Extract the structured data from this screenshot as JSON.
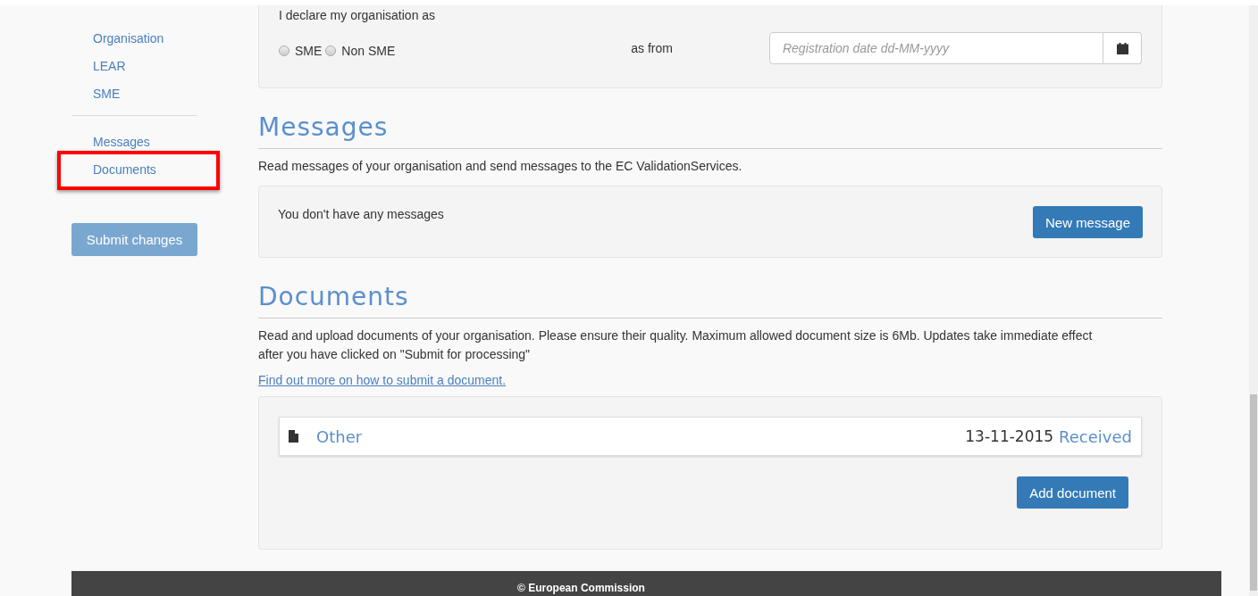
{
  "sidebar": {
    "groups": [
      {
        "items": [
          {
            "label": "Organisation",
            "highlighted": false
          },
          {
            "label": "LEAR",
            "highlighted": false
          },
          {
            "label": "SME",
            "highlighted": false
          }
        ]
      },
      {
        "items": [
          {
            "label": "Messages",
            "highlighted": false
          },
          {
            "label": "Documents",
            "highlighted": true
          }
        ]
      }
    ],
    "submit_button": {
      "label": "Submit changes",
      "disabled": true
    }
  },
  "declaration": {
    "label": "I declare my organisation as",
    "options": [
      {
        "label": "SME",
        "checked": false
      },
      {
        "label": "Non SME",
        "checked": false
      }
    ],
    "as_from": "as from",
    "date_field": {
      "placeholder": "Registration date dd-MM-yyyy"
    }
  },
  "messages": {
    "heading": "Messages",
    "description": "Read messages of your organisation and send messages to the EC ValidationServices.",
    "empty_text": "You don't have any messages",
    "button": "New message"
  },
  "documents": {
    "heading": "Documents",
    "description": "Read and upload documents of your organisation. Please ensure their quality. Maximum allowed document size is 6Mb. Updates take immediate effect after you have clicked on \"Submit for processing\"",
    "link": "Find out more on how to submit a document.",
    "items": [
      {
        "name": "Other",
        "date": "13-11-2015",
        "status": "Received"
      }
    ],
    "button": "Add document"
  },
  "footer": "© European Commission"
}
